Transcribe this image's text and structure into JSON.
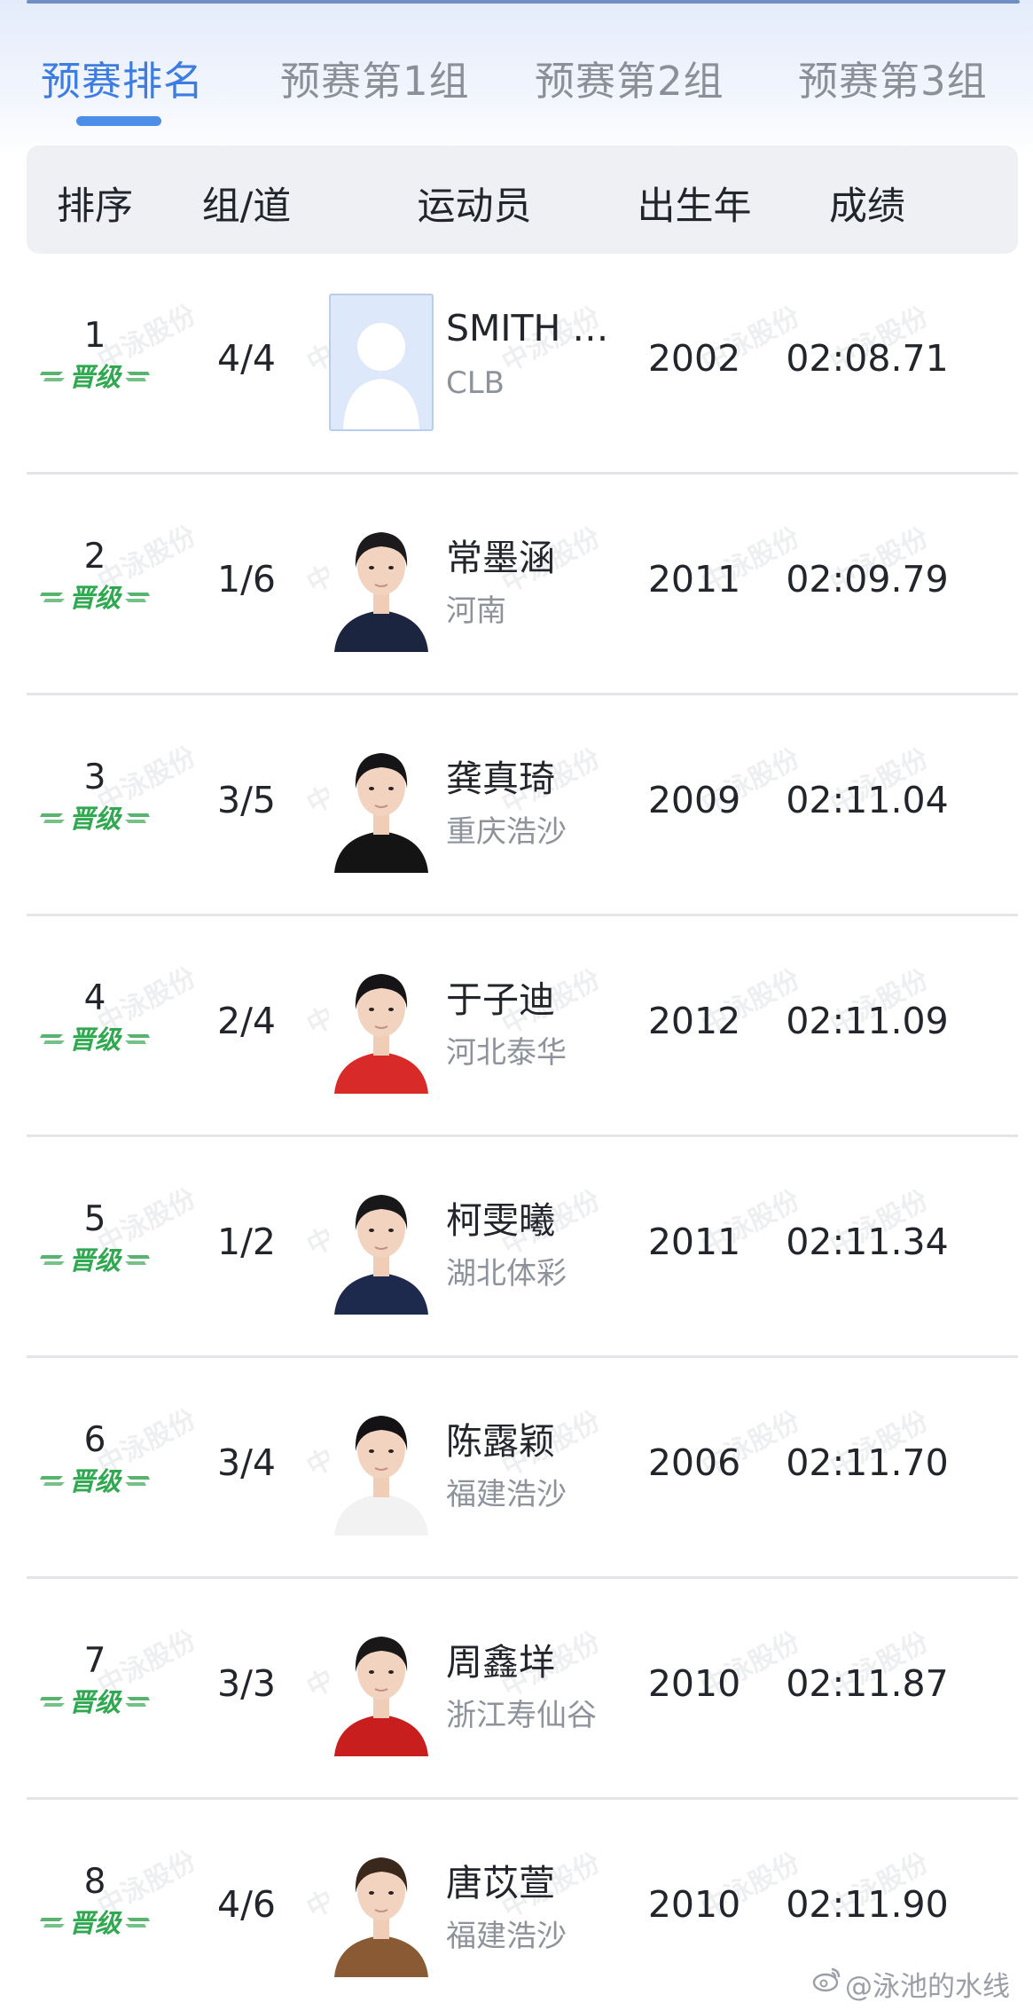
{
  "tabs": [
    {
      "label": "预赛排名",
      "active": true
    },
    {
      "label": "预赛第1组",
      "active": false
    },
    {
      "label": "预赛第2组",
      "active": false
    },
    {
      "label": "预赛第3组",
      "active": false
    }
  ],
  "columns": {
    "rank": "排序",
    "heat_lane": "组/道",
    "athlete": "运动员",
    "birth_year": "出生年",
    "result": "成绩"
  },
  "qualified_label": "晋级",
  "watermark_text": "中泳股份",
  "rows": [
    {
      "rank": "1",
      "heat_lane": "4/4",
      "name": "SMITH …",
      "team": "CLB",
      "year": "2002",
      "result": "02:08.71",
      "photo": "placeholder",
      "shirt": "#cfdcf3",
      "hair": "#c9d8f1"
    },
    {
      "rank": "2",
      "heat_lane": "1/6",
      "name": "常墨涵",
      "team": "河南",
      "year": "2011",
      "result": "02:09.79",
      "photo": "portrait",
      "shirt": "#1b2540",
      "hair": "#1c1a1d"
    },
    {
      "rank": "3",
      "heat_lane": "3/5",
      "name": "龚真琦",
      "team": "重庆浩沙",
      "year": "2009",
      "result": "02:11.04",
      "photo": "portrait",
      "shirt": "#141414",
      "hair": "#151416"
    },
    {
      "rank": "4",
      "heat_lane": "2/4",
      "name": "于子迪",
      "team": "河北泰华",
      "year": "2012",
      "result": "02:11.09",
      "photo": "portrait",
      "shirt": "#d92a2a",
      "hair": "#161416"
    },
    {
      "rank": "5",
      "heat_lane": "1/2",
      "name": "柯雯曦",
      "team": "湖北体彩",
      "year": "2011",
      "result": "02:11.34",
      "photo": "portrait",
      "shirt": "#1e2a4d",
      "hair": "#181719"
    },
    {
      "rank": "6",
      "heat_lane": "3/4",
      "name": "陈露颖",
      "team": "福建浩沙",
      "year": "2006",
      "result": "02:11.70",
      "photo": "portrait",
      "shirt": "#f2f2f2",
      "hair": "#141214"
    },
    {
      "rank": "7",
      "heat_lane": "3/3",
      "name": "周鑫垟",
      "team": "浙江寿仙谷",
      "year": "2010",
      "result": "02:11.87",
      "photo": "portrait",
      "shirt": "#c81e1e",
      "hair": "#1a1718"
    },
    {
      "rank": "8",
      "heat_lane": "4/6",
      "name": "唐苡萱",
      "team": "福建浩沙",
      "year": "2010",
      "result": "02:11.90",
      "photo": "portrait",
      "shirt": "#8a5a35",
      "hair": "#3a281d"
    }
  ],
  "footer": {
    "watermark": "@泳池的水线"
  },
  "colors": {
    "accent": "#3d7ce0",
    "qualified_green": "#2fa84f"
  }
}
